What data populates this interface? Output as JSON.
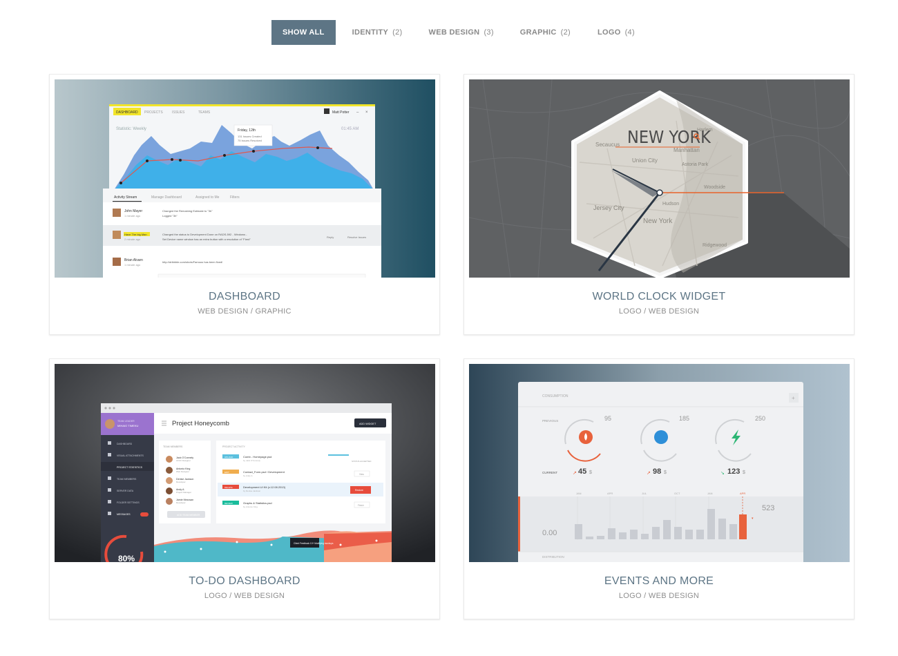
{
  "filters": [
    {
      "label": "SHOW ALL",
      "count": ""
    },
    {
      "label": "IDENTITY",
      "count": "(2)"
    },
    {
      "label": "WEB DESIGN",
      "count": "(3)"
    },
    {
      "label": "GRAPHIC",
      "count": "(2)"
    },
    {
      "label": "LOGO",
      "count": "(4)"
    }
  ],
  "portfolio": [
    {
      "title": "DASHBOARD",
      "categories": "WEB DESIGN / GRAPHIC",
      "thumb": {
        "tabs": [
          "DASHBOARD",
          "PROJECTS",
          "ISSUES",
          "TEAMS"
        ],
        "user": "Matt Potter",
        "stat_label": "Statistic: Weekly",
        "time": "01:45 AM",
        "tooltip_date": "Friday, 12th",
        "tooltip_l1": "131 Issues Created",
        "tooltip_l2": "75 Issues Resolved",
        "stream_tabs": [
          "Activity Stream",
          "Manage Dashboard",
          "Assigned to Me",
          "Filters"
        ],
        "rows": [
          {
            "name": "John Mayer",
            "time": "1 minute ago",
            "text1": "Changed the Remaining Estimate to \"3h\"",
            "text2": "Logged \"3h\""
          },
          {
            "name": "Have The big Man",
            "time": "2 minute ago",
            "text1": "Changed the status to Development Done on RADS-592 - Windows -",
            "text2": "Set Device name window has an extra button with a resolution of \"Fired\"",
            "action1": "Reply",
            "action2": "Resolve Issues"
          },
          {
            "name": "Brian Alvarn",
            "time": "1 minute ago",
            "text1": "http://dribbble.com/shots/Famous has been fixed!",
            "text2": ""
          }
        ]
      }
    },
    {
      "title": "WORLD CLOCK WIDGET",
      "categories": "LOGO / WEB DESIGN",
      "thumb": {
        "city": "NEW YORK",
        "map_labels": [
          "Harlem",
          "Secaucus",
          "Manhattan",
          "Union City",
          "Astoria Park",
          "Woodside",
          "Jersey City",
          "Hudson",
          "New York",
          "Ridgewood"
        ]
      }
    },
    {
      "title": "TO-DO DASHBOARD",
      "categories": "LOGO / WEB DESIGN",
      "thumb": {
        "profile_role": "TEAM LEADER",
        "profile_name": "MIHAIO TIMEKU",
        "project_title": "Project Honeycomb",
        "add_widget": "ADD WIDGET",
        "nav": [
          "DASHBOARD",
          "VISUAL ATTACHMENTS",
          "PROJECT STATISTICS",
          "TEAM MEMBERS",
          "SERVER DATA",
          "FOLDER SETTINGS",
          "MESSAGES"
        ],
        "panel_team": "TEAM MEMBERS",
        "panel_activity": "PROJECT ACTIVITY",
        "members": [
          {
            "name": "Jack O'Connely",
            "role": "UI/UX Designer"
          },
          {
            "name": "Antonio King",
            "role": "Web Designer"
          },
          {
            "name": "Denise Jackson",
            "role": "Developer"
          },
          {
            "name": "Andy A.",
            "role": "Project Manager"
          },
          {
            "name": "Jamie Mezosan",
            "role": "Developer"
          }
        ],
        "add_member": "ADD TEAM MEMBER",
        "activity": [
          {
            "tag": "UPLOAD",
            "title": "Comb - Homepage.psd",
            "sub": "by Jack O'Connely",
            "tag_color": "#5bc0de"
          },
          {
            "tag": "EDIT",
            "title": "Contact_Form.psd / Development",
            "sub": "by Andy A.",
            "tag_color": "#f0ad4e"
          },
          {
            "tag": "DELETE",
            "title": "Development UI Kit (v.12.08.2013)",
            "sub": "by Denise Jackson",
            "tag_color": "#e74c3c"
          },
          {
            "tag": "REVIEW",
            "title": "Graphs & Statistics.psd",
            "sub": "by Antonio King",
            "tag_color": "#1abc9c"
          }
        ],
        "actions": [
          "STATUS ACCEPTED",
          "View",
          "Restore",
          "Finish"
        ],
        "tooltip": "Client Feedback 10+ Modifying mockups",
        "percent": "80%"
      }
    },
    {
      "title": "EVENTS AND MORE",
      "categories": "LOGO / WEB DESIGN",
      "thumb": {
        "header": "CONSUMPTION",
        "previous": "PREVIOUS",
        "current": "CURRENT",
        "gauges": [
          {
            "previous": "95",
            "current": "45",
            "color": "#e8623c",
            "icon": "flame-icon"
          },
          {
            "previous": "185",
            "current": "98",
            "color": "#2e8fd8",
            "icon": "water-drop-icon"
          },
          {
            "previous": "250",
            "current": "123",
            "color": "#2bb673",
            "icon": "lightning-icon"
          }
        ],
        "currency": "$",
        "months": [
          "JAN",
          "APR",
          "JUL",
          "OCT",
          "JAN",
          "APR"
        ],
        "value_left": "0.00",
        "value_right": "523",
        "distribution": "DISTRIBUTION"
      }
    }
  ]
}
